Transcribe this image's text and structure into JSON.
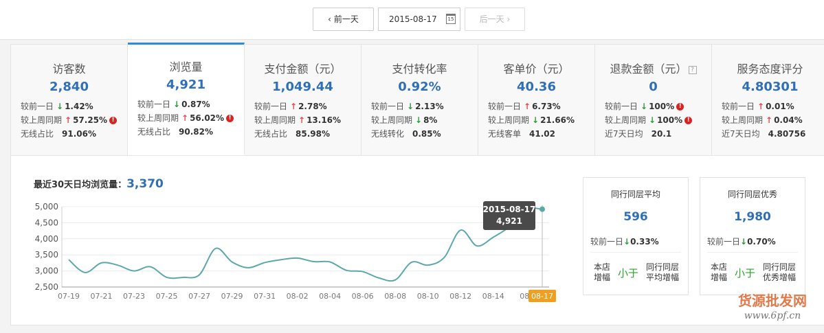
{
  "datebar": {
    "prev_label": "前一天",
    "date": "2015-08-17",
    "calendar_num": "15",
    "next_label": "后一天"
  },
  "metrics": [
    {
      "title": "访客数",
      "value": "2,840",
      "rows": [
        {
          "label": "较前一日",
          "dir": "down",
          "value": "1.42%",
          "warn": false
        },
        {
          "label": "较上周同期",
          "dir": "up",
          "value": "57.25%",
          "warn": true
        },
        {
          "label": "无线占比",
          "dir": "",
          "value": "91.06%",
          "warn": false
        }
      ]
    },
    {
      "title": "浏览量",
      "value": "4,921",
      "rows": [
        {
          "label": "较前一日",
          "dir": "down",
          "value": "0.87%",
          "warn": false
        },
        {
          "label": "较上周同期",
          "dir": "up",
          "value": "56.02%",
          "warn": true
        },
        {
          "label": "无线占比",
          "dir": "",
          "value": "90.82%",
          "warn": false
        }
      ]
    },
    {
      "title": "支付金额（元）",
      "value": "1,049.44",
      "rows": [
        {
          "label": "较前一日",
          "dir": "up",
          "value": "2.78%",
          "warn": false
        },
        {
          "label": "较上周同期",
          "dir": "up",
          "value": "13.16%",
          "warn": false
        },
        {
          "label": "无线占比",
          "dir": "",
          "value": "85.98%",
          "warn": false
        }
      ]
    },
    {
      "title": "支付转化率",
      "value": "0.92%",
      "rows": [
        {
          "label": "较前一日",
          "dir": "down",
          "value": "2.13%",
          "warn": false
        },
        {
          "label": "较上周同期",
          "dir": "down",
          "value": "8%",
          "warn": false
        },
        {
          "label": "无线转化",
          "dir": "",
          "value": "0.85%",
          "warn": false
        }
      ]
    },
    {
      "title": "客单价（元）",
      "value": "40.36",
      "rows": [
        {
          "label": "较前一日",
          "dir": "up",
          "value": "6.73%",
          "warn": false
        },
        {
          "label": "较上周同期",
          "dir": "down",
          "value": "21.66%",
          "warn": false
        },
        {
          "label": "无线客单",
          "dir": "",
          "value": "41.02",
          "warn": false
        }
      ]
    },
    {
      "title": "退款金额（元）",
      "help": "?",
      "value": "0",
      "rows": [
        {
          "label": "较前一日",
          "dir": "down",
          "value": "100%",
          "warn": true
        },
        {
          "label": "较上周同期",
          "dir": "down",
          "value": "100%",
          "warn": true
        },
        {
          "label": "近7天日均",
          "dir": "",
          "value": "20.1",
          "warn": false
        }
      ]
    },
    {
      "title": "服务态度评分",
      "value": "4.80301",
      "rows": [
        {
          "label": "较前一日",
          "dir": "up",
          "value": "0.01%",
          "warn": false
        },
        {
          "label": "较上周同期",
          "dir": "up",
          "value": "0.04%",
          "warn": false
        },
        {
          "label": "近7天日均",
          "dir": "",
          "value": "4.80756",
          "warn": false
        }
      ]
    }
  ],
  "active_metric": 1,
  "chart_header": {
    "label": "最近30天日均浏览量：",
    "value": "3,370"
  },
  "chart_data": {
    "type": "line",
    "ylim": [
      2500,
      5000
    ],
    "yticks": [
      "2,500",
      "3,000",
      "3,500",
      "4,000",
      "4,500",
      "5,000"
    ],
    "xtick_labels": [
      "07-19",
      "07-21",
      "07-23",
      "07-25",
      "07-27",
      "07-29",
      "07-31",
      "08-02",
      "08-04",
      "08-06",
      "08-08",
      "08-10",
      "08-12",
      "08-14",
      "08-"
    ],
    "x": [
      "07-19",
      "07-20",
      "07-21",
      "07-22",
      "07-23",
      "07-24",
      "07-25",
      "07-26",
      "07-27",
      "07-28",
      "07-29",
      "07-30",
      "07-31",
      "08-01",
      "08-02",
      "08-03",
      "08-04",
      "08-05",
      "08-06",
      "08-07",
      "08-08",
      "08-09",
      "08-10",
      "08-11",
      "08-12",
      "08-13",
      "08-14",
      "08-15",
      "08-16",
      "08-17"
    ],
    "values": [
      3350,
      2950,
      3250,
      3180,
      3000,
      3130,
      2800,
      2800,
      2880,
      3700,
      3280,
      3100,
      3260,
      3350,
      3400,
      3290,
      3280,
      3020,
      2980,
      2780,
      2720,
      3270,
      3180,
      3420,
      4270,
      3780,
      4050,
      4380,
      4921,
      4921
    ],
    "highlight_label": "08-17",
    "tooltip": {
      "date": "2015-08-17",
      "value": "4,921"
    },
    "line_color": "#5ba8ab",
    "highlight_color": "#f0a020"
  },
  "peers": [
    {
      "title": "同行同层平均",
      "value": "596",
      "comp_label": "较前一日",
      "dir": "down",
      "comp_value": "0.33%",
      "store_label": "本店增幅",
      "relation": "小于",
      "other_label": "同行同层平均增幅"
    },
    {
      "title": "同行同层优秀",
      "value": "1,980",
      "comp_label": "较前一日",
      "dir": "down",
      "comp_value": "0.70%",
      "store_label": "本店增幅",
      "relation": "小于",
      "other_label": "同行同层优秀增幅"
    }
  ],
  "watermark": {
    "line1": "货源批发网",
    "line2": "www.6pf.cn"
  }
}
